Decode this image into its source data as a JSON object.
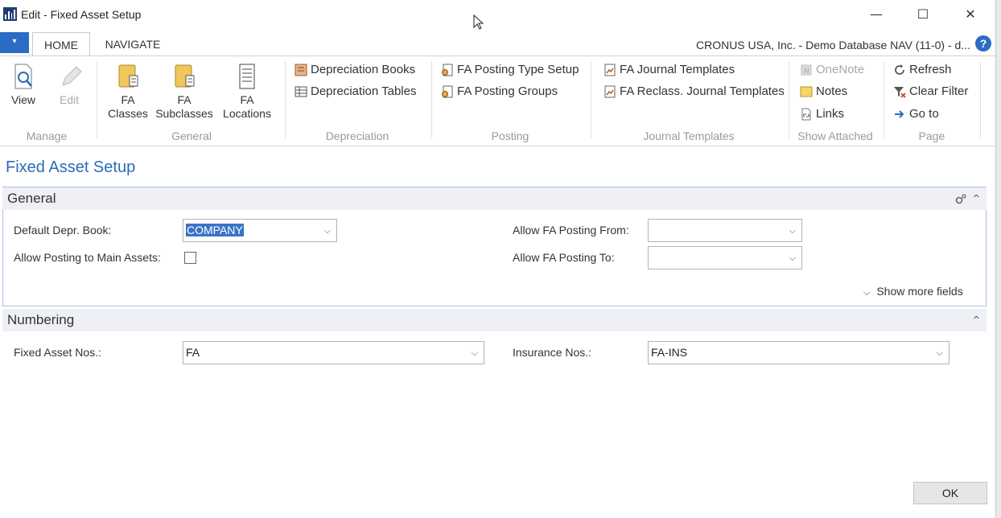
{
  "window": {
    "title": "Edit - Fixed Asset Setup",
    "minimize": "—",
    "maximize": "☐",
    "close": "✕"
  },
  "tabs": {
    "file": "▾",
    "home": "HOME",
    "navigate": "NAVIGATE"
  },
  "company": "CRONUS USA, Inc. - Demo Database NAV (11-0) - d...",
  "help": "?",
  "ribbon": {
    "manage": {
      "label": "Manage",
      "view": "View",
      "edit": "Edit"
    },
    "general": {
      "label": "General",
      "fa_classes": [
        "FA",
        "Classes"
      ],
      "fa_subclasses": [
        "FA",
        "Subclasses"
      ],
      "fa_locations": [
        "FA",
        "Locations"
      ]
    },
    "depreciation": {
      "label": "Depreciation",
      "books": "Depreciation Books",
      "tables": "Depreciation Tables"
    },
    "posting": {
      "label": "Posting",
      "type_setup": "FA Posting Type Setup",
      "groups": "FA Posting Groups"
    },
    "journal": {
      "label": "Journal Templates",
      "fa_journal": "FA Journal Templates",
      "fa_reclass": "FA Reclass. Journal Templates"
    },
    "attached": {
      "label": "Show Attached",
      "onenote": "OneNote",
      "notes": "Notes",
      "links": "Links"
    },
    "page": {
      "label": "Page",
      "refresh": "Refresh",
      "clear_filter": "Clear Filter",
      "goto": "Go to"
    }
  },
  "page_title": "Fixed Asset Setup",
  "general": {
    "header": "General",
    "default_depr_book_label": "Default Depr. Book:",
    "default_depr_book_value": "COMPANY",
    "allow_main_assets_label": "Allow Posting to Main Assets:",
    "allow_main_assets_checked": false,
    "allow_from_label": "Allow FA Posting From:",
    "allow_from_value": "",
    "allow_to_label": "Allow FA Posting To:",
    "allow_to_value": "",
    "show_more": "Show more fields"
  },
  "numbering": {
    "header": "Numbering",
    "fixed_asset_nos_label": "Fixed Asset Nos.:",
    "fixed_asset_nos_value": "FA",
    "insurance_nos_label": "Insurance Nos.:",
    "insurance_nos_value": "FA-INS"
  },
  "ok_button": "OK",
  "colors": {
    "accent": "#2b6cc4",
    "title_blue": "#2a6db5",
    "section_bg": "#eef0f5",
    "selection": "#3a74c6"
  }
}
